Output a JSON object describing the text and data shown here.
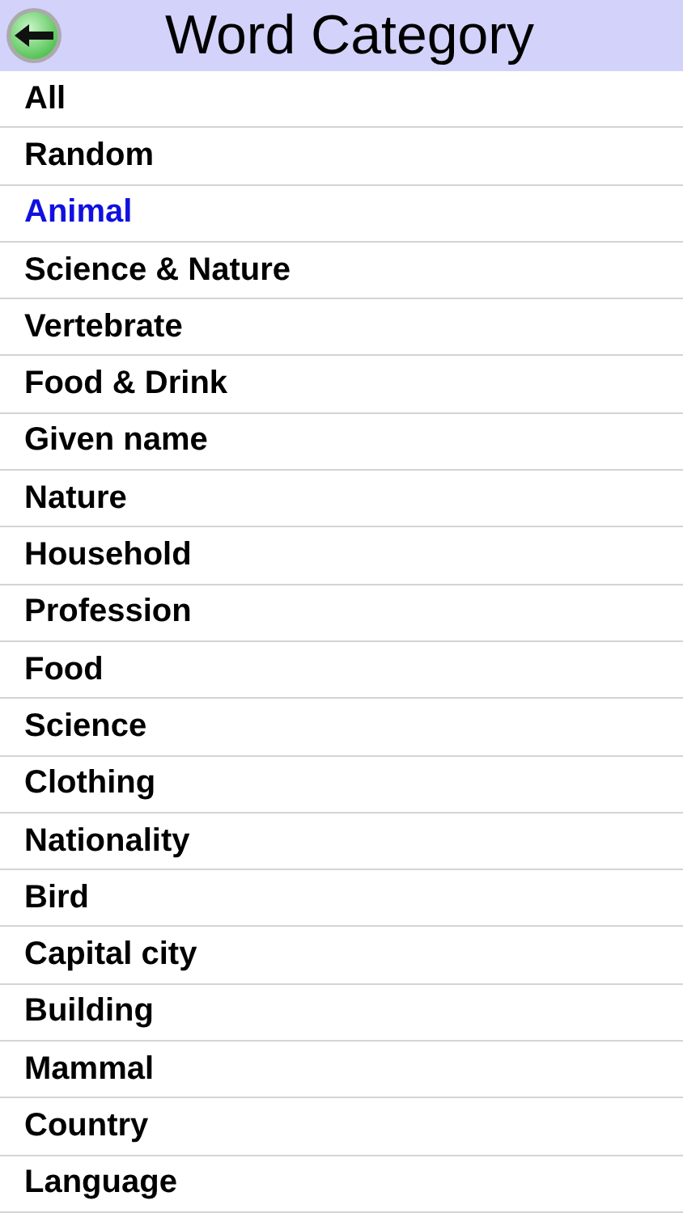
{
  "header": {
    "title": "Word Category"
  },
  "categories": [
    {
      "label": "All",
      "selected": false
    },
    {
      "label": "Random",
      "selected": false
    },
    {
      "label": "Animal",
      "selected": true
    },
    {
      "label": "Science & Nature",
      "selected": false
    },
    {
      "label": "Vertebrate",
      "selected": false
    },
    {
      "label": "Food & Drink",
      "selected": false
    },
    {
      "label": "Given name",
      "selected": false
    },
    {
      "label": "Nature",
      "selected": false
    },
    {
      "label": "Household",
      "selected": false
    },
    {
      "label": "Profession",
      "selected": false
    },
    {
      "label": "Food",
      "selected": false
    },
    {
      "label": "Science",
      "selected": false
    },
    {
      "label": "Clothing",
      "selected": false
    },
    {
      "label": "Nationality",
      "selected": false
    },
    {
      "label": "Bird",
      "selected": false
    },
    {
      "label": "Capital city",
      "selected": false
    },
    {
      "label": "Building",
      "selected": false
    },
    {
      "label": "Mammal",
      "selected": false
    },
    {
      "label": "Country",
      "selected": false
    },
    {
      "label": "Language",
      "selected": false
    }
  ]
}
